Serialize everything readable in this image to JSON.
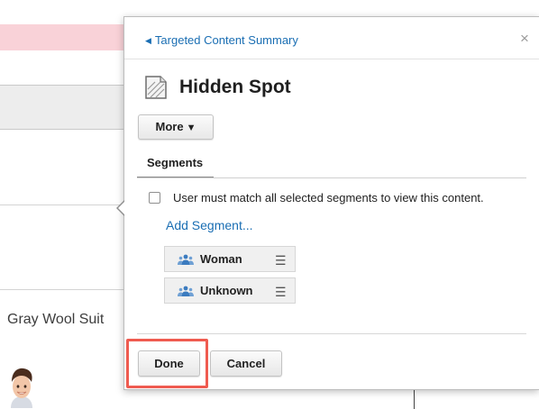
{
  "background": {
    "product_name": "Gray Wool Suit",
    "highlight_color": "#f9d2d8"
  },
  "popover": {
    "back_link_label": "Targeted Content Summary",
    "back_icon": "caret-left-icon",
    "close_label": "×",
    "title": "Hidden Spot",
    "title_icon": "content-spot-icon",
    "more_label": "More",
    "more_icon": "caret-down-icon",
    "tabs": [
      {
        "label": "Segments",
        "active": true
      }
    ],
    "match_all_checkbox": {
      "label": "User must match all selected segments to view this content.",
      "checked": false
    },
    "add_segment_label": "Add Segment...",
    "segments": [
      {
        "name": "Woman",
        "icon": "users-icon",
        "handle_icon": "drag-handle-icon"
      },
      {
        "name": "Unknown",
        "icon": "users-icon",
        "handle_icon": "drag-handle-icon"
      }
    ],
    "buttons": {
      "done_label": "Done",
      "cancel_label": "Cancel"
    },
    "colors": {
      "link": "#1a6eb3",
      "highlight_border": "#ef5b50",
      "segment_icon": "#3b7bbf"
    }
  }
}
